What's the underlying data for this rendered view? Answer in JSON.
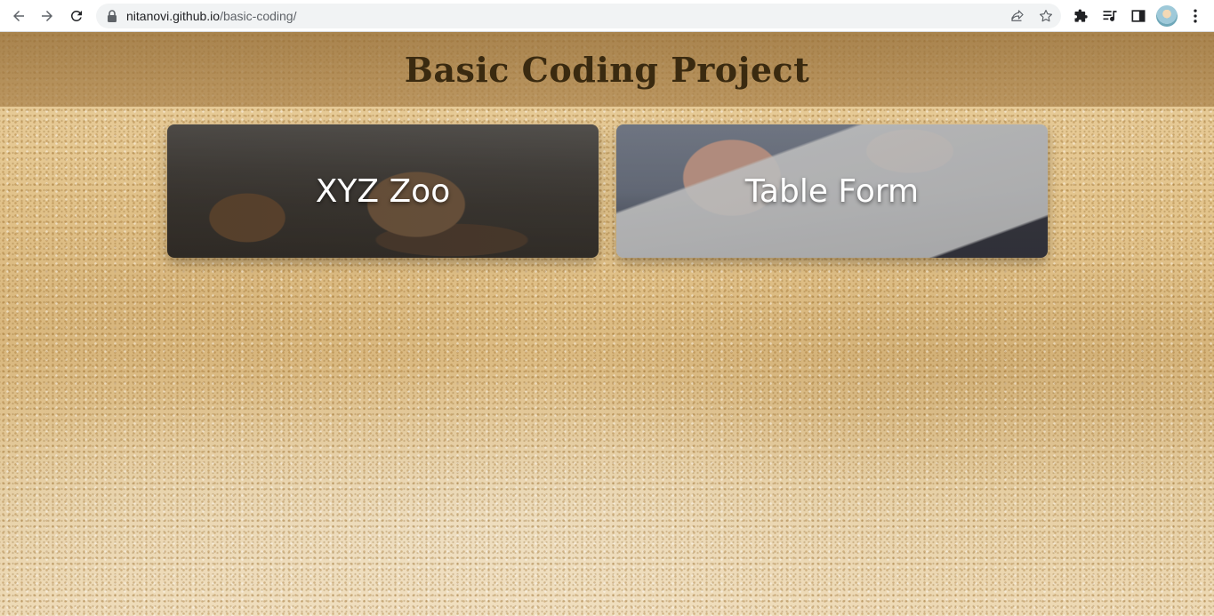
{
  "browser": {
    "url_host": "nitanovi.github.io",
    "url_path": "/basic-coding/",
    "icons": {
      "back": "arrow-left-icon",
      "forward": "arrow-right-icon",
      "reload": "reload-icon",
      "lock": "lock-icon",
      "share": "share-icon",
      "bookmark": "star-icon",
      "extensions": "puzzle-icon",
      "media": "media-queue-icon",
      "side_panel": "side-panel-icon",
      "menu": "kebab-menu-icon"
    }
  },
  "page": {
    "title": "Basic Coding Project",
    "cards": [
      {
        "label": "XYZ Zoo",
        "image": "deer-photo"
      },
      {
        "label": "Table Form",
        "image": "form-writing-photo"
      }
    ]
  },
  "colors": {
    "header_bg": "#9a7444",
    "title_text": "#3a2a10",
    "card_text": "#ffffff",
    "sand": "#e3c48c"
  }
}
